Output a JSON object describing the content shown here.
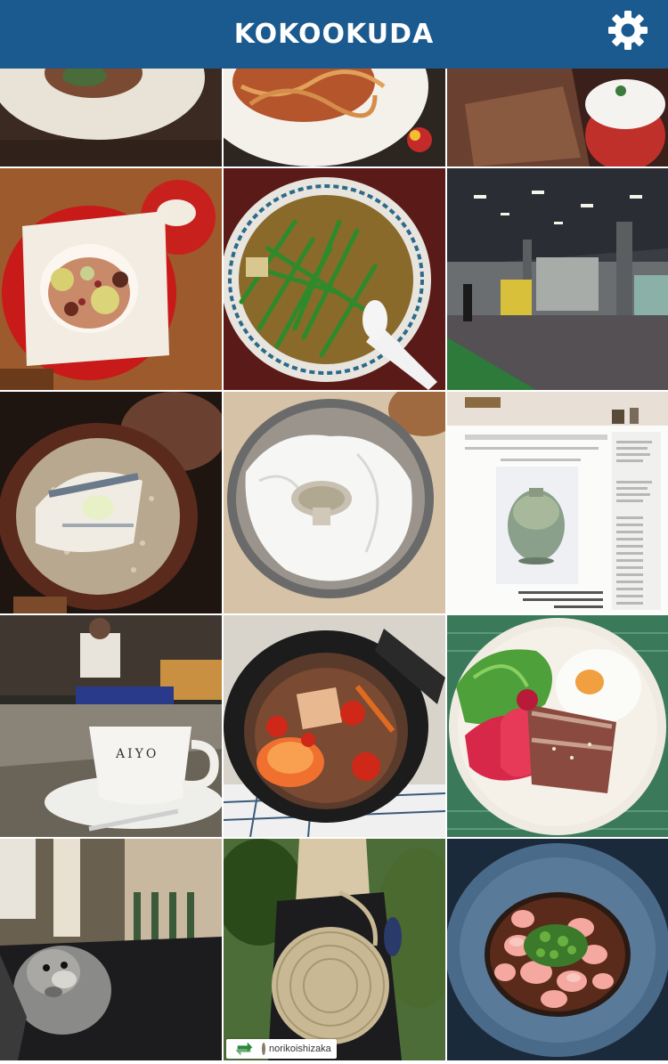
{
  "header": {
    "title": "KOKOOKUDA",
    "settings_icon": "gear-icon",
    "background": "#1b5a8e"
  },
  "grid": {
    "tiles": [
      {
        "alt": "clay bowl dish"
      },
      {
        "alt": "spaghetti with shrimp"
      },
      {
        "alt": "bread and mozzarella tomato"
      },
      {
        "alt": "chestnut rice bowl on red tray"
      },
      {
        "alt": "ramen with greens"
      },
      {
        "alt": "fish market warehouse"
      },
      {
        "alt": "fish in clay pot with barley"
      },
      {
        "alt": "white flowers in metal bowl"
      },
      {
        "alt": "gallery website with vase"
      },
      {
        "alt": "AIYO coffee cup at counter"
      },
      {
        "alt": "tomato stew in cast iron pot"
      },
      {
        "alt": "salad with fried egg and seared fish"
      },
      {
        "alt": "schnauzer dog"
      },
      {
        "alt": "woman with woven round bag"
      },
      {
        "alt": "shirako in blue bowl"
      }
    ],
    "cup_brand": "AIYO",
    "repost": {
      "icon": "repost-icon",
      "username": "norikoishizaka"
    }
  }
}
